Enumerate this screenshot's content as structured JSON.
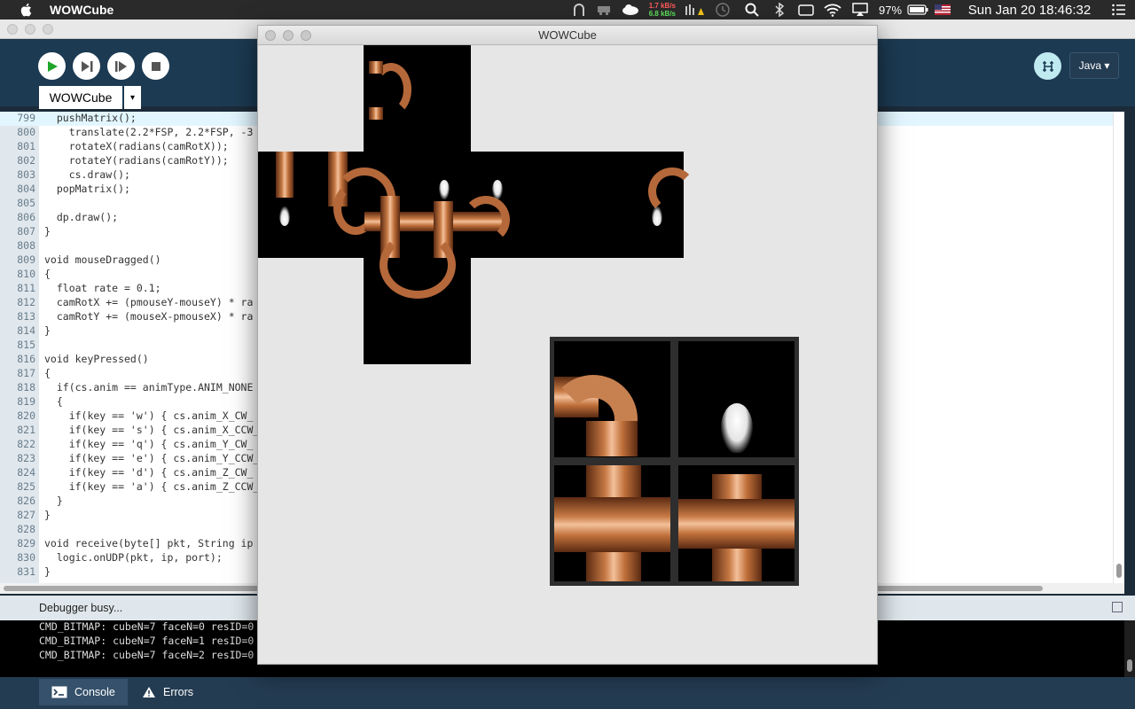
{
  "menubar": {
    "app_name": "WOWCube",
    "net_up": "1.7 kB/s",
    "net_down": "6.8 kB/s",
    "battery": "97%",
    "datetime": "Sun Jan 20  18:46:32"
  },
  "toolbar": {
    "mode_label": "Java ▾"
  },
  "tabs": {
    "sketch_tab": "WOWCube",
    "tab_menu": "▾"
  },
  "editor": {
    "lines": [
      {
        "n": "799",
        "code": "  pushMatrix();"
      },
      {
        "n": "800",
        "code": "    translate(2.2*FSP, 2.2*FSP, -3"
      },
      {
        "n": "801",
        "code": "    rotateX(radians(camRotX));"
      },
      {
        "n": "802",
        "code": "    rotateY(radians(camRotY));"
      },
      {
        "n": "803",
        "code": "    cs.draw();"
      },
      {
        "n": "804",
        "code": "  popMatrix();"
      },
      {
        "n": "805",
        "code": ""
      },
      {
        "n": "806",
        "code": "  dp.draw();"
      },
      {
        "n": "807",
        "code": "}"
      },
      {
        "n": "808",
        "code": ""
      },
      {
        "n": "809",
        "code": "void mouseDragged()"
      },
      {
        "n": "810",
        "code": "{"
      },
      {
        "n": "811",
        "code": "  float rate = 0.1;"
      },
      {
        "n": "812",
        "code": "  camRotX += (pmouseY-mouseY) * ra"
      },
      {
        "n": "813",
        "code": "  camRotY += (mouseX-pmouseX) * ra"
      },
      {
        "n": "814",
        "code": "}"
      },
      {
        "n": "815",
        "code": ""
      },
      {
        "n": "816",
        "code": "void keyPressed()"
      },
      {
        "n": "817",
        "code": "{"
      },
      {
        "n": "818",
        "code": "  if(cs.anim == animType.ANIM_NONE"
      },
      {
        "n": "819",
        "code": "  {"
      },
      {
        "n": "820",
        "code": "    if(key == 'w') { cs.anim_X_CW_"
      },
      {
        "n": "821",
        "code": "    if(key == 's') { cs.anim_X_CCW_"
      },
      {
        "n": "822",
        "code": "    if(key == 'q') { cs.anim_Y_CW_"
      },
      {
        "n": "823",
        "code": "    if(key == 'e') { cs.anim_Y_CCW_"
      },
      {
        "n": "824",
        "code": "    if(key == 'd') { cs.anim_Z_CW_"
      },
      {
        "n": "825",
        "code": "    if(key == 'a') { cs.anim_Z_CCW_"
      },
      {
        "n": "826",
        "code": "  }"
      },
      {
        "n": "827",
        "code": "}"
      },
      {
        "n": "828",
        "code": ""
      },
      {
        "n": "829",
        "code": "void receive(byte[] pkt, String ip"
      },
      {
        "n": "830",
        "code": "  logic.onUDP(pkt, ip, port);"
      },
      {
        "n": "831",
        "code": "}"
      }
    ]
  },
  "status": {
    "message": "Debugger busy..."
  },
  "console": {
    "lines": [
      "CMD_BITMAP: cubeN=7 faceN=0 resID=0",
      "CMD_BITMAP: cubeN=7 faceN=1 resID=0",
      "CMD_BITMAP: cubeN=7 faceN=2 resID=0"
    ]
  },
  "bottom_tabs": {
    "console": "Console",
    "errors": "Errors"
  },
  "sketch_window": {
    "title": "WOWCube"
  }
}
